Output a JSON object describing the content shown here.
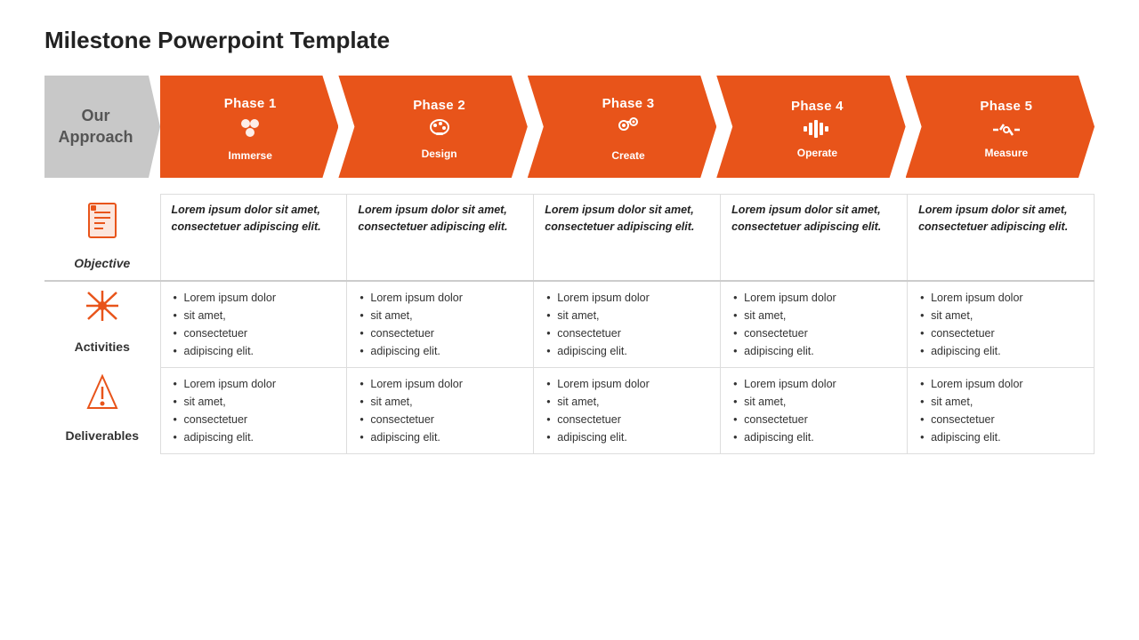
{
  "title": "Milestone Powerpoint Template",
  "approach": {
    "label": "Our\nApproach"
  },
  "phases": [
    {
      "number": "Phase 1",
      "icon": "⬡",
      "name": "Immerse",
      "icon_type": "circles"
    },
    {
      "number": "Phase 2",
      "icon": "🎨",
      "name": "Design",
      "icon_type": "palette"
    },
    {
      "number": "Phase 3",
      "icon": "⚙",
      "name": "Create",
      "icon_type": "gears"
    },
    {
      "number": "Phase 4",
      "icon": "📊",
      "name": "Operate",
      "icon_type": "bars"
    },
    {
      "number": "Phase 5",
      "icon": "◇",
      "name": "Measure",
      "icon_type": "arrows"
    }
  ],
  "rows": [
    {
      "title": "Objective",
      "title_style": "italic",
      "icon": "📋",
      "cells": [
        "Lorem ipsum dolor sit amet, consectetuer adipiscing elit.",
        "Lorem ipsum dolor sit amet, consectetuer adipiscing elit.",
        "Lorem ipsum dolor sit amet, consectetuer adipiscing elit.",
        "Lorem ipsum dolor sit amet, consectetuer adipiscing elit.",
        "Lorem ipsum dolor sit amet, consectetuer adipiscing elit."
      ]
    },
    {
      "title": "Activities",
      "title_style": "normal",
      "icon": "✦",
      "cells": [
        [
          "Lorem ipsum dolor",
          "sit amet,",
          "consectetuer",
          "adipiscing elit."
        ],
        [
          "Lorem ipsum dolor",
          "sit amet,",
          "consectetuer",
          "adipiscing elit."
        ],
        [
          "Lorem ipsum dolor",
          "sit amet,",
          "consectetuer",
          "adipiscing elit."
        ],
        [
          "Lorem ipsum dolor",
          "sit amet,",
          "consectetuer",
          "adipiscing elit."
        ],
        [
          "Lorem ipsum dolor",
          "sit amet,",
          "consectetuer",
          "adipiscing elit."
        ]
      ]
    },
    {
      "title": "Deliverables",
      "title_style": "normal",
      "icon": "⏳",
      "cells": [
        [
          "Lorem ipsum dolor",
          "sit amet,",
          "consectetuer",
          "adipiscing elit."
        ],
        [
          "Lorem ipsum dolor",
          "sit amet,",
          "consectetuer",
          "adipiscing elit."
        ],
        [
          "Lorem ipsum dolor",
          "sit amet,",
          "consectetuer",
          "adipiscing elit."
        ],
        [
          "Lorem ipsum dolor",
          "sit amet,",
          "consectetuer",
          "adipiscing elit."
        ],
        [
          "Lorem ipsum dolor",
          "sit amet,",
          "consectetuer",
          "adipiscing elit."
        ]
      ]
    }
  ],
  "colors": {
    "orange": "#e8541a",
    "gray": "#c8c8c8",
    "border": "#dddddd"
  }
}
